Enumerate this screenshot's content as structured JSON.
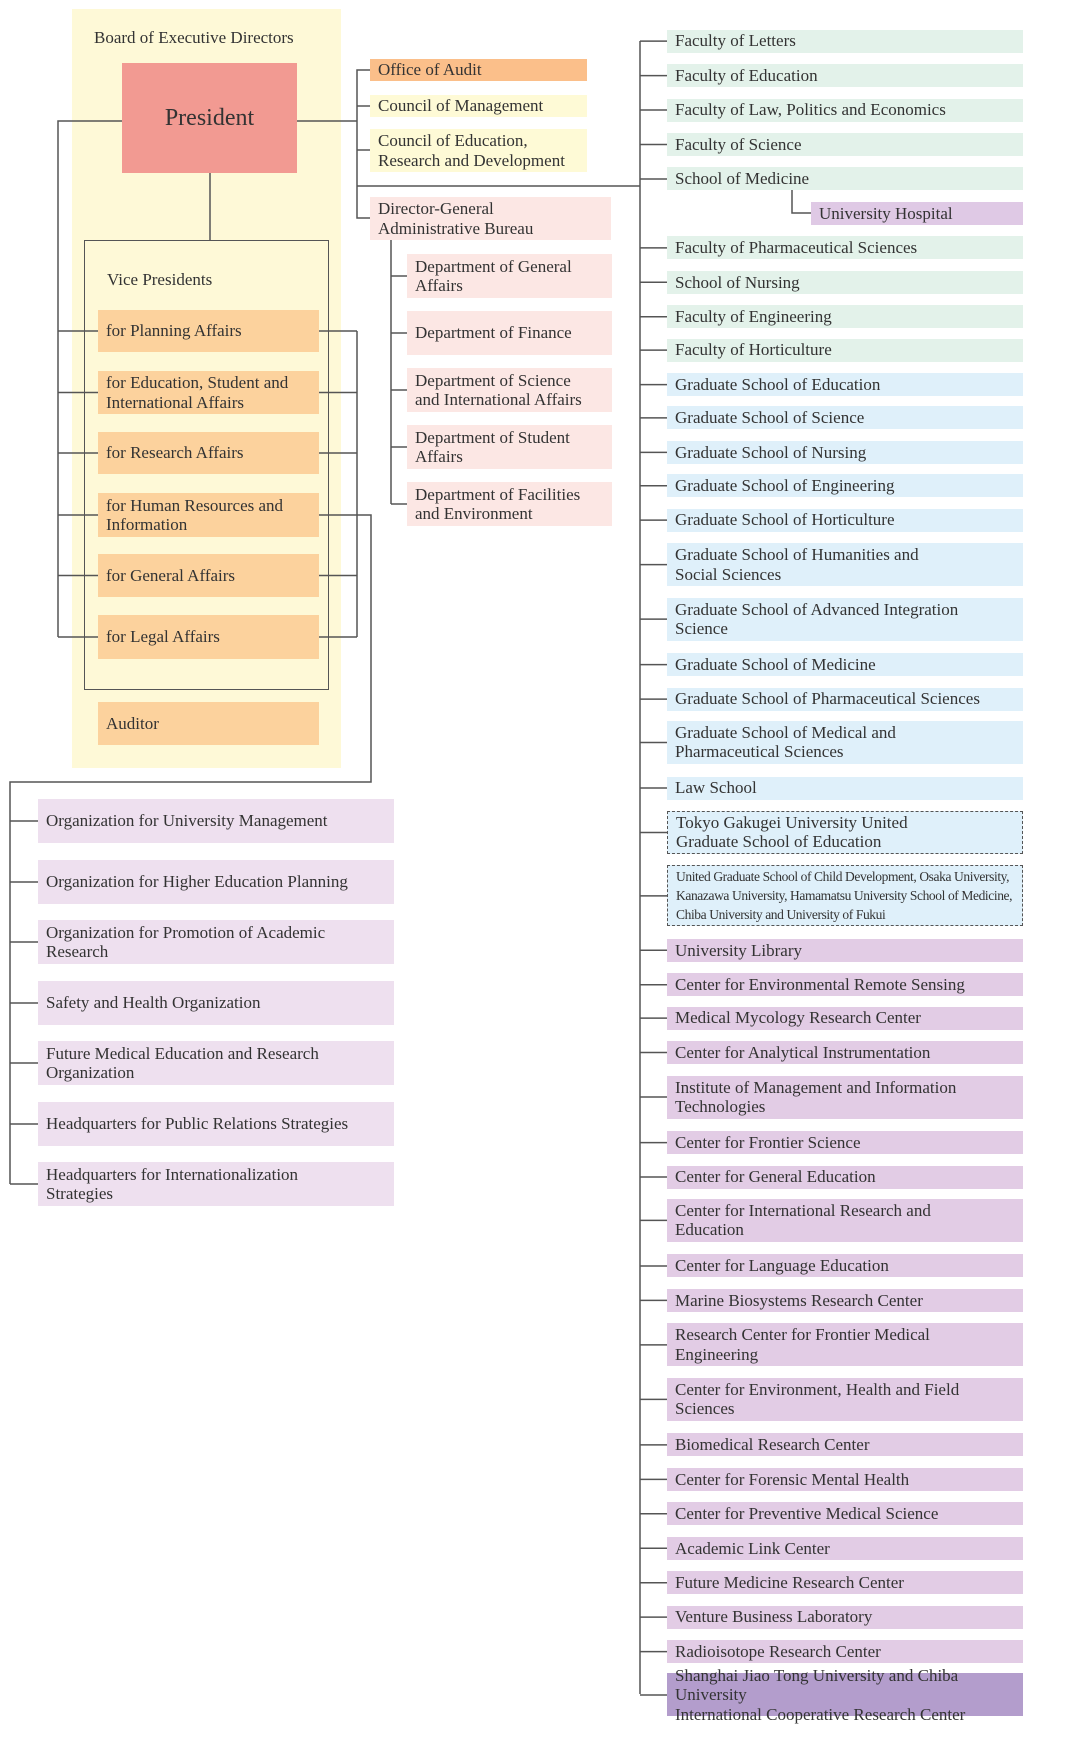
{
  "board": {
    "title": "Board of Executive Directors",
    "president": "President",
    "vice_presidents_title": "Vice Presidents",
    "vice_presidents": [
      "for Planning Affairs",
      "for Education, Student and\nInternational Affairs",
      "for Research Affairs",
      "for Human Resources and\nInformation",
      "for General Affairs",
      "for Legal Affairs"
    ],
    "auditor": "Auditor"
  },
  "central": {
    "office_of_audit": "Office of Audit",
    "council_management": "Council of Management",
    "council_education": "Council of Education,\nResearch and Development",
    "director_general": "Director-General\nAdministrative Bureau",
    "departments": [
      "Department of General\nAffairs",
      "Department of Finance",
      "Department of Science\nand International Affairs",
      "Department of Student\nAffairs",
      "Department of Facilities\nand Environment"
    ]
  },
  "organizations": [
    "Organization for University Management",
    "Organization for Higher Education Planning",
    "Organization for Promotion of Academic\nResearch",
    "Safety and Health Organization",
    "Future Medical Education and Research\nOrganization",
    "Headquarters for Public Relations Strategies",
    "Headquarters for Internationalization\nStrategies"
  ],
  "units": [
    {
      "label": "Faculty of Letters",
      "type": "faculty"
    },
    {
      "label": "Faculty of Education",
      "type": "faculty"
    },
    {
      "label": "Faculty of Law, Politics and Economics",
      "type": "faculty"
    },
    {
      "label": "Faculty of Science",
      "type": "faculty"
    },
    {
      "label": "School of Medicine",
      "type": "faculty"
    },
    {
      "label": "University Hospital",
      "type": "hospital"
    },
    {
      "label": "Faculty of Pharmaceutical Sciences",
      "type": "faculty"
    },
    {
      "label": "School of Nursing",
      "type": "faculty"
    },
    {
      "label": "Faculty of Engineering",
      "type": "faculty"
    },
    {
      "label": "Faculty of Horticulture",
      "type": "faculty"
    },
    {
      "label": "Graduate School of Education",
      "type": "graduate"
    },
    {
      "label": "Graduate School of Science",
      "type": "graduate"
    },
    {
      "label": "Graduate School of Nursing",
      "type": "graduate"
    },
    {
      "label": "Graduate School of Engineering",
      "type": "graduate"
    },
    {
      "label": "Graduate School of Horticulture",
      "type": "graduate"
    },
    {
      "label": "Graduate School of Humanities and\nSocial Sciences",
      "type": "graduate"
    },
    {
      "label": "Graduate School of Advanced Integration\nScience",
      "type": "graduate"
    },
    {
      "label": "Graduate School of Medicine",
      "type": "graduate"
    },
    {
      "label": "Graduate School of Pharmaceutical Sciences",
      "type": "graduate"
    },
    {
      "label": "Graduate School of Medical and\nPharmaceutical Sciences",
      "type": "graduate"
    },
    {
      "label": "Law School",
      "type": "graduate"
    },
    {
      "label": "Tokyo Gakugei University United\nGraduate School of Education",
      "type": "united"
    },
    {
      "label": "United Graduate School of Child Development, Osaka University,\nKanazawa University, Hamamatsu University School of Medicine,\nChiba University and University of Fukui",
      "type": "united-small"
    },
    {
      "label": "University Library",
      "type": "center"
    },
    {
      "label": "Center for Environmental Remote Sensing",
      "type": "center"
    },
    {
      "label": "Medical Mycology Research Center",
      "type": "center"
    },
    {
      "label": "Center for Analytical Instrumentation",
      "type": "center"
    },
    {
      "label": "Institute of Management and Information\nTechnologies",
      "type": "center"
    },
    {
      "label": "Center for Frontier Science",
      "type": "center"
    },
    {
      "label": "Center for General Education",
      "type": "center"
    },
    {
      "label": "Center for International Research and\nEducation",
      "type": "center"
    },
    {
      "label": "Center for Language Education",
      "type": "center"
    },
    {
      "label": "Marine Biosystems Research Center",
      "type": "center"
    },
    {
      "label": "Research Center for Frontier Medical\nEngineering",
      "type": "center"
    },
    {
      "label": "Center for Environment, Health and Field\nSciences",
      "type": "center"
    },
    {
      "label": "Biomedical Research Center",
      "type": "center"
    },
    {
      "label": "Center for Forensic Mental Health",
      "type": "center"
    },
    {
      "label": "Center for Preventive Medical Science",
      "type": "center"
    },
    {
      "label": "Academic Link Center",
      "type": "center"
    },
    {
      "label": "Future Medicine Research Center",
      "type": "center"
    },
    {
      "label": "Venture Business Laboratory",
      "type": "center"
    },
    {
      "label": "Radioisotope Research Center",
      "type": "center"
    },
    {
      "label": "Shanghai Jiao Tong University and Chiba University\nInternational Cooperative Research Center",
      "type": "joint"
    }
  ],
  "colors": {
    "board_background": "#fef9d7",
    "president": "#f29a92",
    "vice_president": "#fcd29d",
    "office_of_audit": "#fbbf8a",
    "council": "#fefad6",
    "administrative": "#fce7e4",
    "organization": "#eee0ef",
    "faculty": "#e3f2ea",
    "graduate": "#dff0fa",
    "united": "#dff0fa",
    "united-small": "#dff0fa",
    "center": "#e2cce5",
    "hospital": "#dfc9e5",
    "joint": "#b39dcc",
    "line": "#555555"
  }
}
